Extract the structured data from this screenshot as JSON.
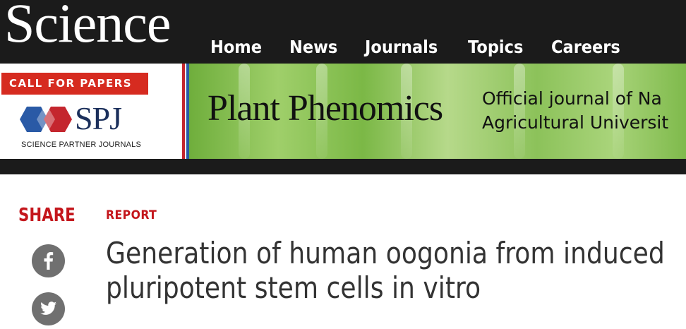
{
  "header": {
    "logo": "Science",
    "nav": [
      "Home",
      "News",
      "Journals",
      "Topics",
      "Careers"
    ]
  },
  "banner": {
    "call_for_papers": "CALL FOR PAPERS",
    "spj_logo": "SPJ",
    "spj_subtitle": "SCIENCE PARTNER JOURNALS",
    "journal_title": "Plant Phenomics",
    "official_line1": "Official journal of Na",
    "official_line2": "Agricultural Universit",
    "colors": {
      "call_for_papers_bg": "#d62b20",
      "spj_navy": "#1b2f5b",
      "spj_red": "#c4262e"
    }
  },
  "article": {
    "share_label": "SHARE",
    "share_icons": [
      "facebook-icon",
      "twitter-icon"
    ],
    "type": "REPORT",
    "title_line1": "Generation of human oogonia from induced",
    "title_line2": "pluripotent stem cells in vitro",
    "colors": {
      "accent": "#c4161c"
    }
  }
}
